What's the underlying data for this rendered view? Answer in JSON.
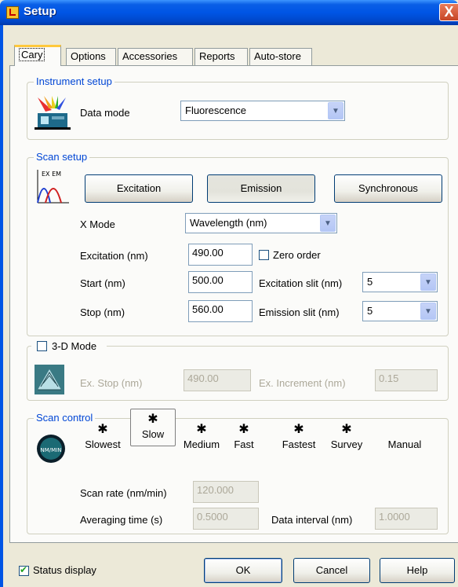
{
  "window": {
    "title": "Setup",
    "close_glyph": "X"
  },
  "tabs": [
    {
      "label": "Cary",
      "active": true
    },
    {
      "label": "Options"
    },
    {
      "label": "Accessories"
    },
    {
      "label": "Reports"
    },
    {
      "label": "Auto-store"
    }
  ],
  "instrument_setup": {
    "legend": "Instrument setup",
    "data_mode_label": "Data mode",
    "data_mode_value": "Fluorescence",
    "icon": "instrument-icon"
  },
  "scan_setup": {
    "legend": "Scan setup",
    "icon_text": "EX EM",
    "buttons": {
      "excitation": "Excitation",
      "emission": "Emission",
      "synchronous": "Synchronous"
    },
    "xmode_label": "X Mode",
    "xmode_value": "Wavelength (nm)",
    "excitation_label": "Excitation (nm)",
    "excitation_value": "490.00",
    "zero_order_label": "Zero order",
    "start_label": "Start (nm)",
    "start_value": "500.00",
    "stop_label": "Stop (nm)",
    "stop_value": "560.00",
    "ex_slit_label": "Excitation slit (nm)",
    "ex_slit_value": "5",
    "em_slit_label": "Emission slit (nm)",
    "em_slit_value": "5"
  },
  "mode3d": {
    "label": "3-D Mode",
    "checked": false,
    "ex_stop_label": "Ex. Stop (nm)",
    "ex_stop_value": "490.00",
    "ex_increment_label": "Ex. Increment (nm)",
    "ex_increment_value": "0.15"
  },
  "scan_control": {
    "legend": "Scan control",
    "gauge_text": "NM/MIN",
    "speeds": [
      "Slowest",
      "Slow",
      "Medium",
      "Fast",
      "Fastest",
      "Survey",
      "Manual"
    ],
    "selected_speed": "Slow",
    "scan_rate_label": "Scan rate (nm/min)",
    "scan_rate_value": "120.000",
    "averaging_label": "Averaging time (s)",
    "averaging_value": "0.5000",
    "data_interval_label": "Data interval (nm)",
    "data_interval_value": "1.0000"
  },
  "footer": {
    "status_label": "Status display",
    "status_checked": true,
    "ok": "OK",
    "cancel": "Cancel",
    "help": "Help"
  }
}
